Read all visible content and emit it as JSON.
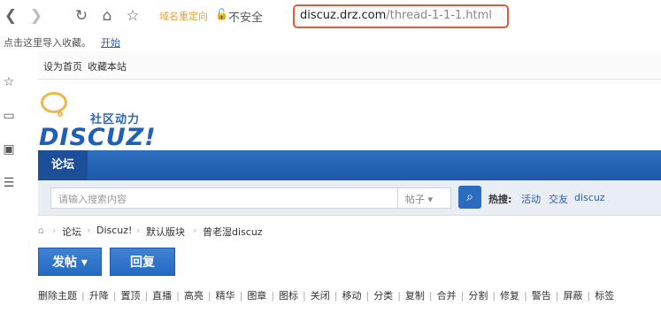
{
  "browser": {
    "redirect_tag": "域名重定向",
    "insecure_label": "不安全",
    "url_host": "discuz.drz.com",
    "url_path": "/thread-1-1-1.html"
  },
  "bookmarks": {
    "import_text": "点击这里导入收藏。",
    "import_link": "开始"
  },
  "topnav": {
    "set_home": "设为首页",
    "bookmark_site": "收藏本站"
  },
  "logo": {
    "cn": "社区动力",
    "en": "DISCUZ!"
  },
  "mainnav": {
    "active_tab": "论坛"
  },
  "search": {
    "placeholder": "请输入搜索内容",
    "type": "帖子 ▾",
    "hot_label": "热搜:",
    "hot_items": [
      "活动",
      "交友",
      "discuz"
    ]
  },
  "breadcrumb": {
    "items": [
      "论坛",
      "Discuz!",
      "默认版块",
      "曾老湿discuz"
    ]
  },
  "actions": {
    "post": "发帖 ▾",
    "reply": "回复"
  },
  "moderation": [
    "删除主题",
    "升降",
    "置顶",
    "直播",
    "高亮",
    "精华",
    "图章",
    "图标",
    "关闭",
    "移动",
    "分类",
    "复制",
    "合并",
    "分割",
    "修复",
    "警告",
    "屏蔽",
    "标签"
  ]
}
